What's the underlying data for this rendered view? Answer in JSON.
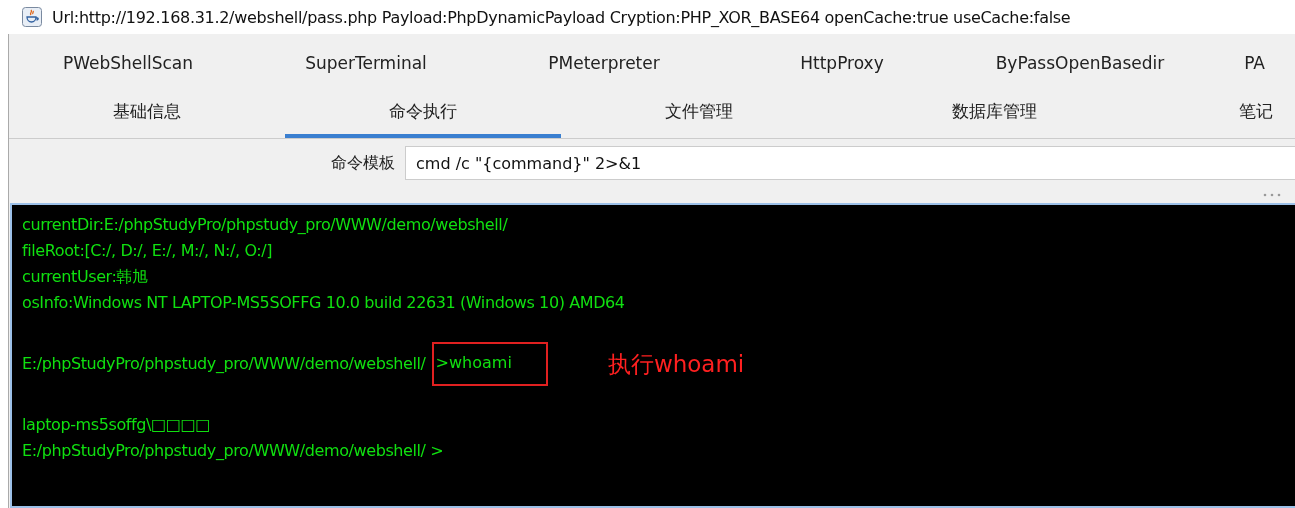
{
  "window": {
    "title": "Url:http://192.168.31.2/webshell/pass.php Payload:PhpDynamicPayload Cryption:PHP_XOR_BASE64 openCache:true useCache:false"
  },
  "plugin_tabs": [
    {
      "label": "PWebShellScan",
      "selected": false
    },
    {
      "label": "SuperTerminal",
      "selected": false
    },
    {
      "label": "PMeterpreter",
      "selected": false
    },
    {
      "label": "HttpProxy",
      "selected": false
    },
    {
      "label": "ByPassOpenBasedir",
      "selected": false
    },
    {
      "label": "PA",
      "selected": false
    }
  ],
  "main_tabs": [
    {
      "label": "基础信息",
      "selected": false
    },
    {
      "label": "命令执行",
      "selected": true
    },
    {
      "label": "文件管理",
      "selected": false
    },
    {
      "label": "数据库管理",
      "selected": false
    },
    {
      "label": "笔记",
      "selected": false
    }
  ],
  "command_template": {
    "label": "命令模板",
    "value": "cmd /c \"{command}\" 2>&1"
  },
  "terminal": {
    "blocks": [
      {
        "kind": "output",
        "lines": [
          "currentDir:E:/phpStudyPro/phpstudy_pro/WWW/demo/webshell/",
          "fileRoot:[C:/, D:/, E:/, M:/, N:/, O:/]",
          "currentUser:韩旭",
          "osInfo:Windows NT LAPTOP-MS5SOFFG 10.0 build 22631 (Windows 10) AMD64"
        ]
      },
      {
        "kind": "command",
        "prompt": "E:/phpStudyPro/phpstudy_pro/WWW/demo/webshell/",
        "command": ">whoami",
        "highlighted": true,
        "annotation": "执行whoami"
      },
      {
        "kind": "output",
        "lines": [
          "laptop-ms5soffg\\□□□□",
          "E:/phpStudyPro/phpstudy_pro/WWW/demo/webshell/ >"
        ]
      }
    ]
  }
}
